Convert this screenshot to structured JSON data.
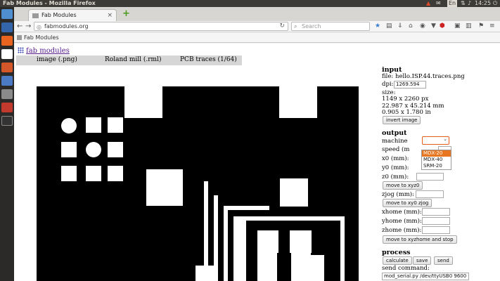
{
  "system": {
    "window_title": "Fab Modules - Mozilla Firefox",
    "clock": "14:25",
    "keyboard_indicator": "En"
  },
  "browser": {
    "tab_title": "Fab Modules",
    "tab_close": "×",
    "new_tab": "+",
    "url": "fabmodules.org",
    "search_placeholder": "Search",
    "bookmark_label": "Fab Modules"
  },
  "page": {
    "logo_text": "fab modules",
    "menu": {
      "input": "image (.png)",
      "process": "Roland mill (.rml)",
      "output": "PCB traces (1/64)"
    },
    "input_section": {
      "heading": "input",
      "file": "file: hello.ISP.44.traces.png",
      "dpi_label": "dpi:",
      "dpi_value": "1269.594",
      "size_label": "size:",
      "size_px": "1149 x 2260 px",
      "size_mm": "22.987 x 45.214 mm",
      "size_in": "0.905 x 1.780 in",
      "invert_button": "invert image"
    },
    "output_section": {
      "heading": "output",
      "machine_label": "machine",
      "machine_options": [
        "MDX-20",
        "MDX-40",
        "SRM-20"
      ],
      "speed_label": "speed (m",
      "x0_label": "x0 (mm):",
      "y0_label": "y0 (mm):",
      "z0_label": "z0 (mm):",
      "move_xyz0": "move to xyz0",
      "zjog_label": "zjog (mm):",
      "move_xy0zjog": "move to xy0 zjog",
      "xhome_label": "xhome (mm):",
      "yhome_label": "yhome (mm):",
      "zhome_label": "zhome (mm):",
      "move_home": "move to xyzhome and stop"
    },
    "process_section": {
      "heading": "process",
      "calculate": "calculate",
      "save": "save",
      "send": "send",
      "send_command_label": "send command:",
      "send_command_value": "mod_serial.py /dev/ttyUSB0 9600 -"
    }
  },
  "colors": {
    "accent": "#e85d1a",
    "panel_bg": "#3c3b37",
    "launcher_bg": "#2b2a28"
  }
}
